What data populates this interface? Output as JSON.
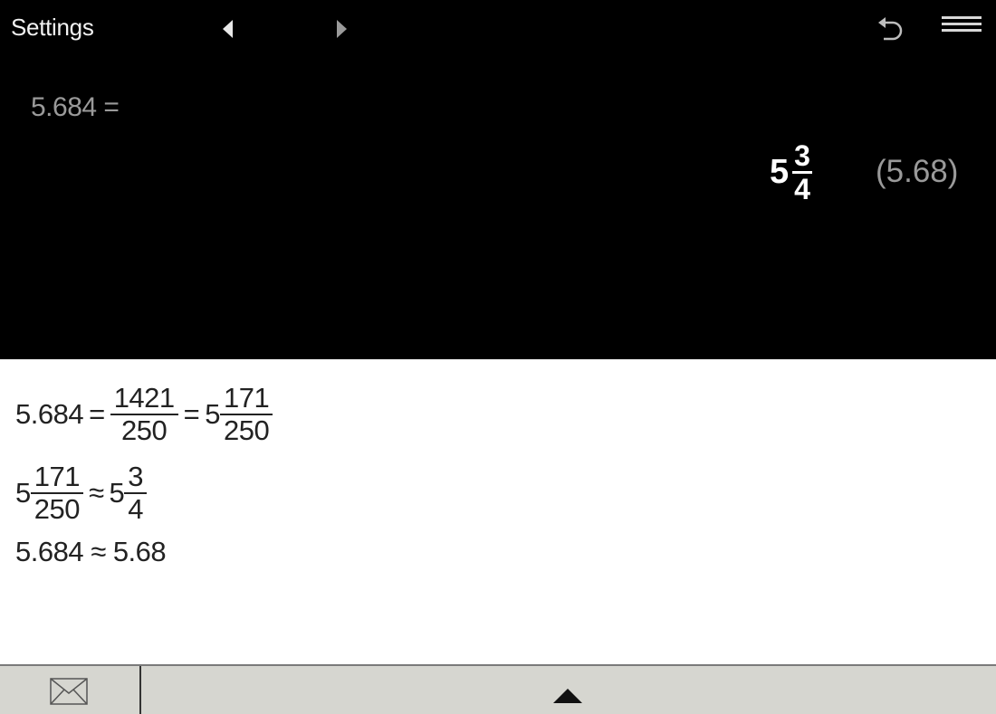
{
  "header": {
    "settings_label": "Settings",
    "icons": [
      "triangle-left-icon",
      "triangle-right-icon",
      "undo-icon",
      "menu-icon"
    ]
  },
  "display": {
    "input": "5.684 =",
    "result_whole": "5",
    "result_num": "3",
    "result_den": "4",
    "result_decimal": "(5.68)"
  },
  "steps": {
    "line1": {
      "lhs": "5.684",
      "eq1": "=",
      "f_num": "1421",
      "f_den": "250",
      "eq2": "=",
      "m_whole": "5",
      "m_num": "171",
      "m_den": "250"
    },
    "line2": {
      "m_whole": "5",
      "m_num": "171",
      "m_den": "250",
      "approx": "≈",
      "r_whole": "5",
      "r_num": "3",
      "r_den": "4"
    },
    "line3": {
      "text": "5.684 ≈ 5.68"
    }
  },
  "footer": {
    "icons": [
      "mail-icon",
      "expand-up-icon"
    ]
  },
  "colors": {
    "display_bg": "#000000",
    "footer_bg": "#d6d6d0",
    "muted_text": "#9a9a9a"
  }
}
